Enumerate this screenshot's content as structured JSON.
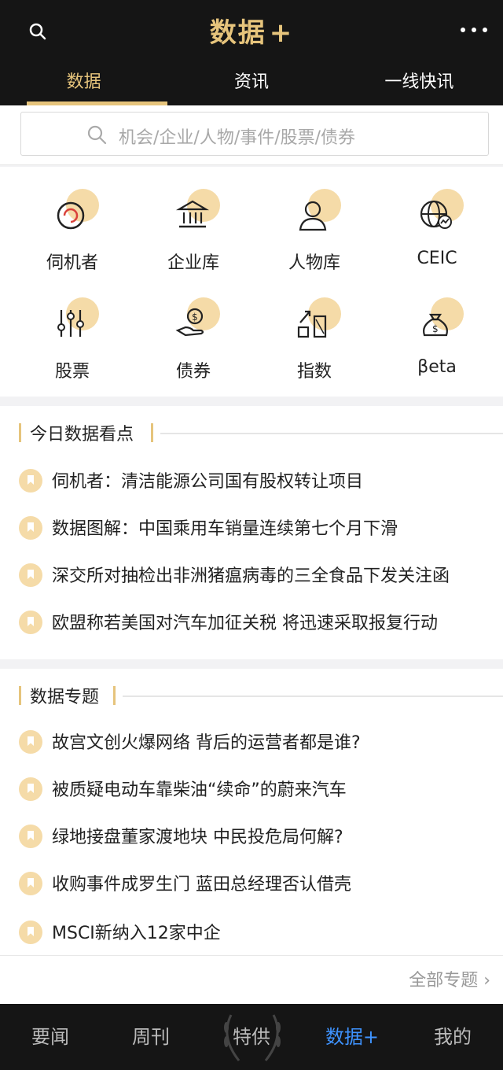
{
  "header": {
    "logo_text": "数据",
    "logo_plus": "+",
    "tabs": [
      {
        "label": "数据",
        "active": true
      },
      {
        "label": "资讯",
        "active": false
      },
      {
        "label": "一线快讯",
        "active": false
      }
    ]
  },
  "search": {
    "placeholder": "机会/企业/人物/事件/股票/债券"
  },
  "grid": [
    {
      "label": "伺机者",
      "icon": "opportunity-icon"
    },
    {
      "label": "企业库",
      "icon": "bank-icon"
    },
    {
      "label": "人物库",
      "icon": "person-icon"
    },
    {
      "label": "CEIC",
      "icon": "globe-chart-icon"
    },
    {
      "label": "股票",
      "icon": "sliders-icon"
    },
    {
      "label": "债券",
      "icon": "hand-coin-icon"
    },
    {
      "label": "指数",
      "icon": "bar-arrow-icon"
    },
    {
      "label": "βeta",
      "icon": "money-bag-icon"
    }
  ],
  "today": {
    "title": "今日数据看点",
    "items": [
      "伺机者：清洁能源公司国有股权转让项目",
      "数据图解：中国乘用车销量连续第七个月下滑",
      "深交所对抽检出非洲猪瘟病毒的三全食品下发关注函",
      "欧盟称若美国对汽车加征关税 将迅速采取报复行动"
    ]
  },
  "topics": {
    "title": "数据专题",
    "items": [
      "故宫文创火爆网络 背后的运营者都是谁?",
      "被质疑电动车靠柴油“续命”的蔚来汽车",
      "绿地接盘董家渡地块 中民投危局何解?",
      "收购事件成罗生门 蓝田总经理否认借壳",
      "MSCI新纳入12家中企"
    ],
    "all_label": "全部专题 ›"
  },
  "bottom_nav": [
    {
      "label": "要闻",
      "active": false
    },
    {
      "label": "周刊",
      "active": false
    },
    {
      "label": "特供",
      "active": false
    },
    {
      "label": "数据+",
      "active": true
    },
    {
      "label": "我的",
      "active": false
    }
  ],
  "colors": {
    "accent": "#e6c47c",
    "nav_active": "#3e93ff",
    "header_bg": "#151515"
  }
}
